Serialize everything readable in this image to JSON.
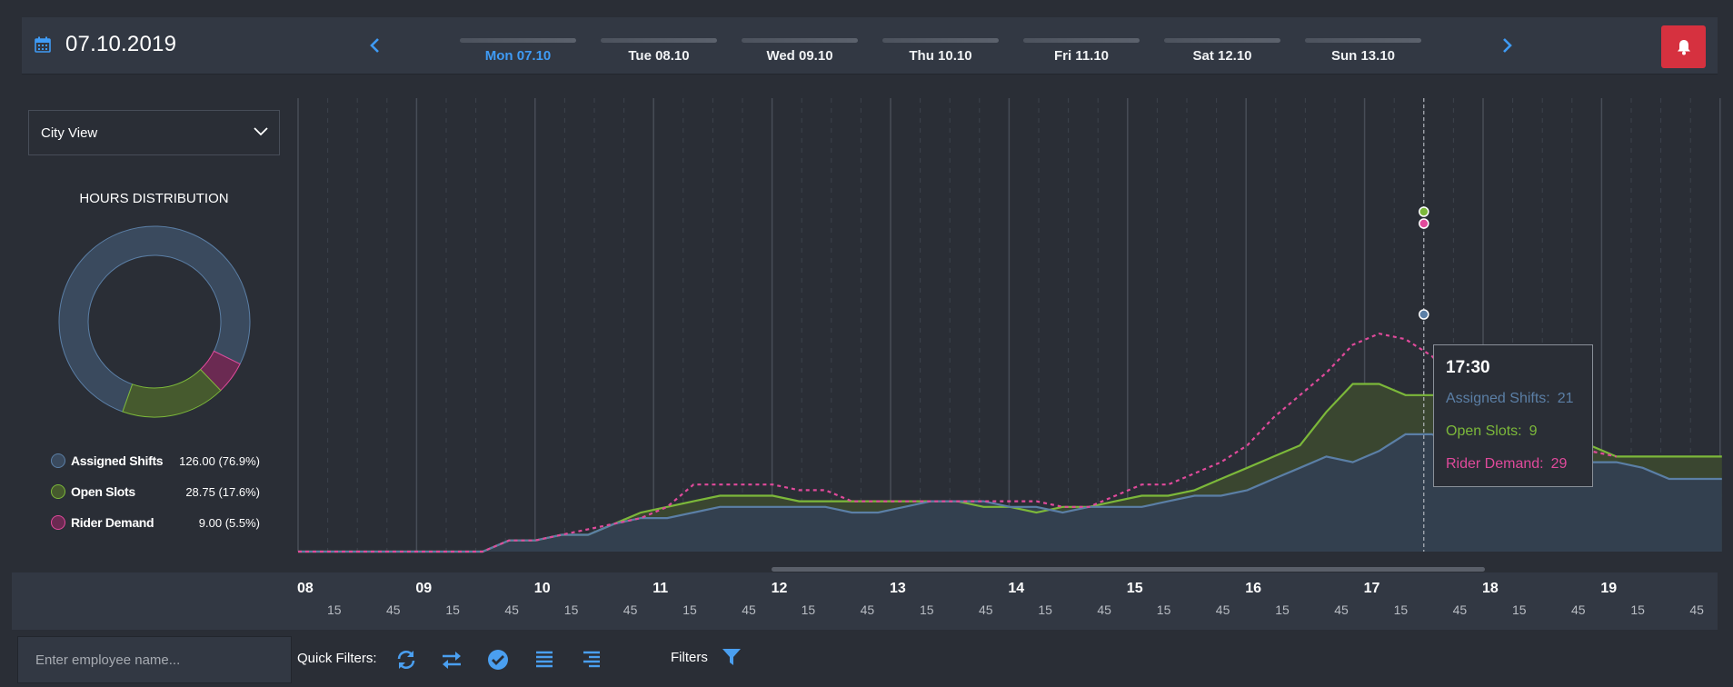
{
  "header": {
    "date": "07.10.2019",
    "days": [
      {
        "label": "Mon 07.10",
        "active": true
      },
      {
        "label": "Tue 08.10",
        "active": false
      },
      {
        "label": "Wed 09.10",
        "active": false
      },
      {
        "label": "Thu 10.10",
        "active": false
      },
      {
        "label": "Fri 11.10",
        "active": false
      },
      {
        "label": "Sat 12.10",
        "active": false
      },
      {
        "label": "Sun 13.10",
        "active": false
      }
    ],
    "icons": [
      "calendar-icon",
      "chevron-left-icon",
      "chevron-right-icon",
      "bell-icon"
    ],
    "accent_color": "#3f9bf5",
    "bell_color": "#d6313f"
  },
  "sidebar": {
    "view_select": "City View",
    "distribution_title": "HOURS DISTRIBUTION",
    "legend": [
      {
        "name": "Assigned Shifts",
        "value": "126.00 (76.9%)",
        "color": "#3a4a5e",
        "stroke": "#5b7fa6",
        "share": 0.769
      },
      {
        "name": "Open Slots",
        "value": "28.75 (17.6%)",
        "color": "#465a2e",
        "stroke": "#7cb83a",
        "share": 0.176
      },
      {
        "name": "Rider Demand",
        "value": "9.00 (5.5%)",
        "color": "#6b2a52",
        "stroke": "#e04a9b",
        "share": 0.055
      }
    ]
  },
  "chart_data": {
    "type": "area",
    "x_unit": "minutes from 08:00, 5-minute steps",
    "x": [
      0,
      5,
      10,
      15,
      20,
      25,
      30,
      35,
      40,
      45,
      50,
      55,
      60,
      65,
      70,
      75,
      80,
      85,
      90,
      95,
      100,
      105,
      110,
      115,
      120,
      125,
      130,
      135,
      140,
      145,
      150,
      155,
      160,
      165,
      170,
      175,
      180,
      185,
      190,
      195,
      200,
      205,
      210,
      215,
      220,
      225,
      230,
      235,
      240,
      245,
      250,
      255,
      260,
      265,
      270,
      275,
      280,
      285,
      290,
      295,
      300,
      305,
      310,
      315,
      320,
      325,
      330,
      335,
      340,
      345,
      350,
      355,
      360,
      365,
      370,
      375,
      380,
      385,
      390,
      395,
      400,
      405,
      410,
      415,
      420,
      425,
      430,
      435,
      440,
      445,
      450,
      455,
      460,
      465,
      470,
      475,
      480,
      485,
      490,
      495,
      500,
      505,
      510,
      515,
      520,
      525,
      530,
      535,
      540,
      545,
      550,
      555,
      560,
      565,
      570,
      575,
      580,
      585,
      590,
      595,
      600,
      605,
      610,
      615,
      620,
      625,
      630,
      635,
      640,
      645,
      650,
      655,
      660,
      665,
      670,
      675,
      680,
      685,
      690,
      695,
      700,
      705,
      710,
      715,
      720,
      725
    ],
    "series": [
      {
        "name": "Assigned Shifts",
        "color": "#5b7fa6",
        "values": [
          0,
          0,
          0,
          0,
          0,
          0,
          0,
          0,
          0,
          0,
          0,
          0,
          0,
          0,
          0,
          0,
          0,
          0,
          0,
          0,
          0,
          0,
          0,
          0,
          0,
          0,
          0,
          0,
          0,
          0,
          0,
          0,
          0,
          0,
          0,
          0,
          0,
          0,
          0,
          0,
          0,
          0,
          0,
          0,
          0,
          0,
          0,
          0,
          0,
          0,
          0,
          0,
          0,
          0,
          0,
          0,
          0,
          0,
          0,
          0,
          0,
          0,
          0,
          0,
          0,
          0,
          0,
          0,
          0,
          0,
          0,
          0,
          0,
          0,
          0,
          0,
          0,
          0,
          0,
          0,
          0,
          0,
          0,
          0,
          0,
          0,
          0,
          0,
          0,
          0,
          0,
          0,
          0,
          0,
          0,
          0,
          0,
          0,
          0,
          0,
          0,
          0,
          0,
          0,
          0,
          0,
          0,
          0,
          0,
          0,
          0,
          0,
          0,
          0,
          0,
          0,
          0,
          0,
          0,
          0,
          0,
          0,
          0,
          0,
          0,
          0,
          0,
          0,
          0,
          0,
          0,
          0,
          0,
          0,
          0,
          0,
          0,
          0,
          0,
          0,
          0,
          0,
          0,
          0,
          0,
          0
        ]
      },
      {
        "name": "Open Slots",
        "color": "#7cb83a",
        "values": []
      },
      {
        "name": "Rider Demand",
        "color": "#e04a9b",
        "values": []
      }
    ],
    "points": {
      "assigned": [
        [
          0,
          0
        ],
        [
          35,
          0
        ],
        [
          40,
          1
        ],
        [
          45,
          1
        ],
        [
          50,
          1.5
        ],
        [
          55,
          1.5
        ],
        [
          60,
          2.5
        ],
        [
          65,
          3
        ],
        [
          70,
          3
        ],
        [
          75,
          3.5
        ],
        [
          80,
          4
        ],
        [
          85,
          4
        ],
        [
          90,
          4
        ],
        [
          95,
          4
        ],
        [
          100,
          4
        ],
        [
          105,
          3.5
        ],
        [
          110,
          3.5
        ],
        [
          115,
          4
        ],
        [
          120,
          4.5
        ],
        [
          125,
          4.5
        ],
        [
          130,
          4.5
        ],
        [
          135,
          4
        ],
        [
          140,
          4
        ],
        [
          145,
          3.5
        ],
        [
          150,
          4
        ],
        [
          155,
          4
        ],
        [
          160,
          4
        ],
        [
          165,
          4.5
        ],
        [
          170,
          5
        ],
        [
          175,
          5
        ],
        [
          180,
          5.5
        ],
        [
          185,
          6.5
        ],
        [
          190,
          7.5
        ],
        [
          195,
          8.5
        ],
        [
          200,
          8
        ],
        [
          205,
          9
        ],
        [
          210,
          10.5
        ],
        [
          215,
          10.5
        ],
        [
          220,
          9.5
        ],
        [
          225,
          9.5
        ],
        [
          230,
          9.5
        ],
        [
          235,
          9.5
        ],
        [
          240,
          8.5
        ],
        [
          245,
          8
        ],
        [
          250,
          8
        ],
        [
          255,
          7.5
        ],
        [
          260,
          6.5
        ],
        [
          265,
          6.5
        ],
        [
          270,
          6.5
        ]
      ],
      "open": [
        [
          0,
          0
        ],
        [
          35,
          0
        ],
        [
          40,
          1
        ],
        [
          45,
          1
        ],
        [
          50,
          1.5
        ],
        [
          55,
          1.5
        ],
        [
          60,
          2.5
        ],
        [
          65,
          3.5
        ],
        [
          70,
          4
        ],
        [
          75,
          4.5
        ],
        [
          80,
          5
        ],
        [
          85,
          5
        ],
        [
          90,
          5
        ],
        [
          95,
          4.5
        ],
        [
          100,
          4.5
        ],
        [
          105,
          4.5
        ],
        [
          110,
          4.5
        ],
        [
          115,
          4.5
        ],
        [
          120,
          4.5
        ],
        [
          125,
          4.5
        ],
        [
          130,
          4
        ],
        [
          135,
          4
        ],
        [
          140,
          3.5
        ],
        [
          145,
          4
        ],
        [
          150,
          4
        ],
        [
          155,
          4.5
        ],
        [
          160,
          5
        ],
        [
          165,
          5
        ],
        [
          170,
          5.5
        ],
        [
          175,
          6.5
        ],
        [
          180,
          7.5
        ],
        [
          185,
          8.5
        ],
        [
          190,
          9.5
        ],
        [
          195,
          12.5
        ],
        [
          200,
          15
        ],
        [
          205,
          15
        ],
        [
          210,
          14
        ],
        [
          215,
          14
        ],
        [
          220,
          14
        ],
        [
          225,
          14
        ],
        [
          230,
          14
        ],
        [
          235,
          12.5
        ],
        [
          240,
          12
        ],
        [
          245,
          9.5
        ],
        [
          250,
          8.5
        ],
        [
          255,
          8.5
        ],
        [
          260,
          8.5
        ],
        [
          265,
          8.5
        ],
        [
          270,
          8.5
        ]
      ],
      "demand": [
        [
          0,
          0
        ],
        [
          35,
          0
        ],
        [
          40,
          1
        ],
        [
          45,
          1
        ],
        [
          50,
          1.5
        ],
        [
          55,
          2
        ],
        [
          60,
          2.5
        ],
        [
          65,
          3
        ],
        [
          70,
          4
        ],
        [
          75,
          6
        ],
        [
          80,
          6
        ],
        [
          85,
          6
        ],
        [
          90,
          6
        ],
        [
          95,
          5.5
        ],
        [
          100,
          5.5
        ],
        [
          105,
          4.5
        ],
        [
          110,
          4.5
        ],
        [
          115,
          4.5
        ],
        [
          120,
          4.5
        ],
        [
          125,
          4.5
        ],
        [
          130,
          4.5
        ],
        [
          135,
          4.5
        ],
        [
          140,
          4.5
        ],
        [
          145,
          4
        ],
        [
          150,
          4
        ],
        [
          155,
          5
        ],
        [
          160,
          6
        ],
        [
          165,
          6
        ],
        [
          170,
          7
        ],
        [
          175,
          8
        ],
        [
          180,
          9.5
        ],
        [
          185,
          12
        ],
        [
          190,
          14
        ],
        [
          195,
          16
        ],
        [
          200,
          18.5
        ],
        [
          205,
          19.5
        ],
        [
          210,
          19
        ],
        [
          215,
          17.5
        ],
        [
          220,
          15
        ],
        [
          225,
          12
        ],
        [
          230,
          11
        ],
        [
          235,
          10
        ],
        [
          240,
          9.5
        ],
        [
          245,
          9
        ],
        [
          250,
          8.5
        ]
      ]
    },
    "x_axis": {
      "hours": [
        "08",
        "09",
        "10",
        "11",
        "12",
        "13",
        "14",
        "15",
        "16",
        "17",
        "18",
        "19"
      ],
      "minute_ticks": [
        "15",
        "45"
      ]
    },
    "hover": {
      "time": "17:30",
      "rows": [
        {
          "label": "Assigned Shifts:",
          "value": "21",
          "color": "#5b7fa6"
        },
        {
          "label": "Open Slots:",
          "value": "9",
          "color": "#7cb83a"
        },
        {
          "label": "Rider Demand:",
          "value": "29",
          "color": "#e04a9b"
        }
      ]
    }
  },
  "bottom": {
    "employee_placeholder": "Enter employee name...",
    "quick_filters_label": "Quick Filters:",
    "quick_filter_icons": [
      "refresh-icon",
      "swap-icon",
      "check-circle-icon",
      "list-icon",
      "align-right-icon"
    ],
    "filters_label": "Filters",
    "filter_icon": "funnel-icon"
  }
}
